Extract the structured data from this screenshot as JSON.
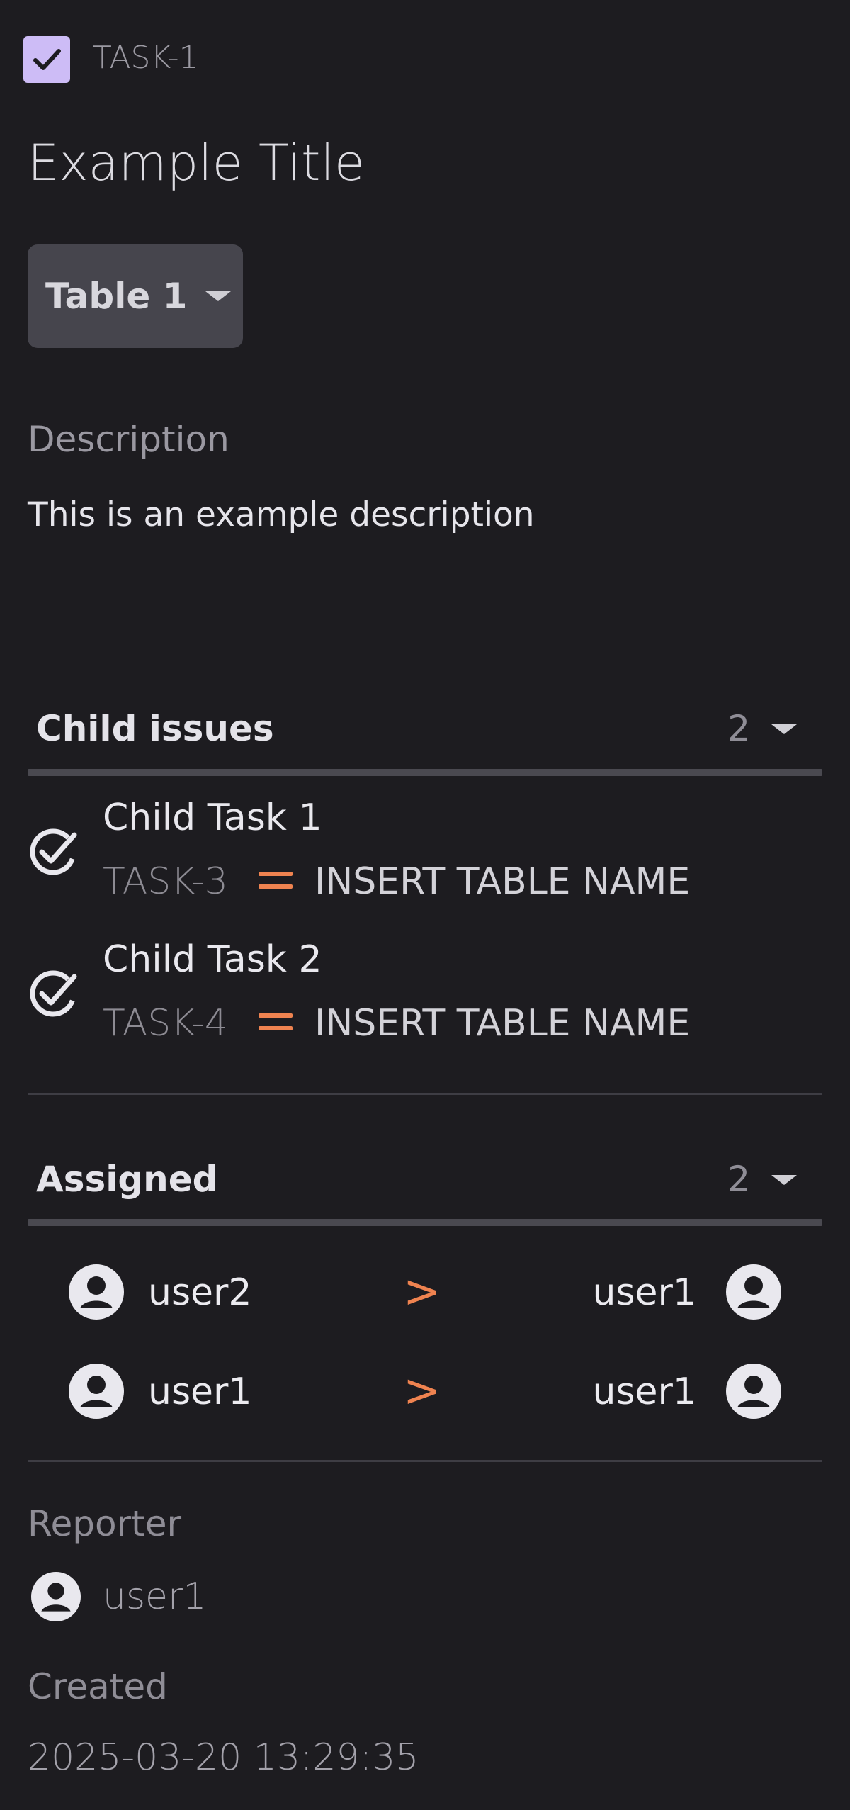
{
  "header": {
    "task_key": "TASK-1",
    "title": "Example Title",
    "checked": true,
    "checkbox_color": "#cdbcf6",
    "check_icon": "check-icon"
  },
  "table_select": {
    "label": "Table 1"
  },
  "description": {
    "label": "Description",
    "text": "This is an example description"
  },
  "child_issues": {
    "title": "Child issues",
    "count": "2",
    "items": [
      {
        "title": "Child Task 1",
        "key": "TASK-3",
        "table": "INSERT TABLE NAME",
        "priority_icon": "priority-medium-icon",
        "status_icon": "check-circle-icon"
      },
      {
        "title": "Child Task 2",
        "key": "TASK-4",
        "table": "INSERT TABLE NAME",
        "priority_icon": "priority-medium-icon",
        "status_icon": "check-circle-icon"
      }
    ]
  },
  "assigned": {
    "title": "Assigned",
    "count": "2",
    "arrow": ">",
    "items": [
      {
        "from": "user2",
        "to": "user1"
      },
      {
        "from": "user1",
        "to": "user1"
      }
    ]
  },
  "reporter": {
    "label": "Reporter",
    "name": "user1"
  },
  "created": {
    "label": "Created",
    "value": "2025-03-20 13:29:35"
  },
  "colors": {
    "background": "#1d1c20",
    "accent": "#ef8350",
    "checkbox": "#cdbcf6",
    "select_bg": "#46454d"
  }
}
